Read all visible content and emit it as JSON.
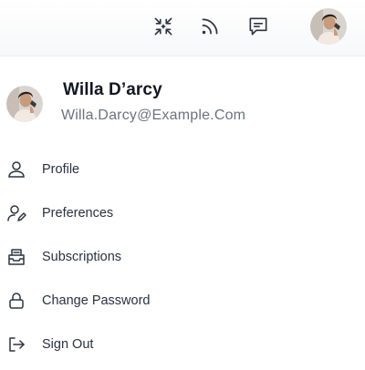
{
  "topbar": {
    "icons": [
      "compress-icon",
      "rss-feed-icon",
      "message-icon"
    ],
    "avatar_icon": "user-avatar"
  },
  "profile": {
    "name": "Willa D’arcy",
    "email": "Willa.Darcy@Example.Com"
  },
  "menu": {
    "items": [
      {
        "label": "Profile",
        "icon": "user-icon"
      },
      {
        "label": "Preferences",
        "icon": "user-edit-icon"
      },
      {
        "label": "Subscriptions",
        "icon": "inbox-icon"
      },
      {
        "label": "Change Password",
        "icon": "lock-icon"
      },
      {
        "label": "Sign Out",
        "icon": "sign-out-icon"
      }
    ]
  }
}
